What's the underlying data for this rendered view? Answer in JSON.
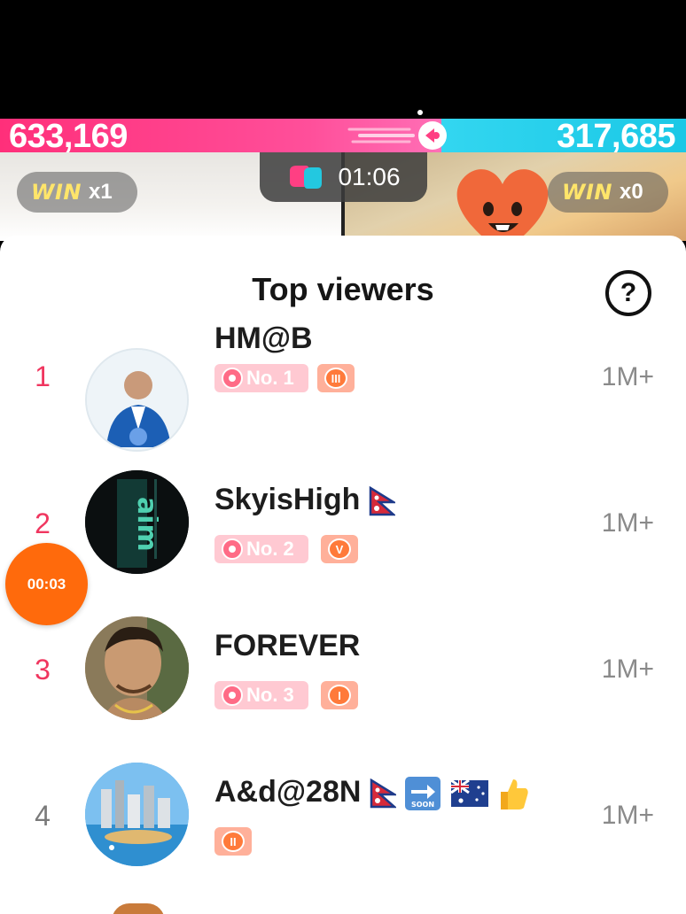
{
  "battle": {
    "left_score": "633,169",
    "right_score": "317,685",
    "timer": "01:06",
    "left_win_label": "WIN",
    "left_win_count": "x1",
    "right_win_label": "WIN",
    "right_win_count": "x0"
  },
  "sheet": {
    "title": "Top viewers",
    "help_icon": "?"
  },
  "viewers": [
    {
      "rank": "1",
      "name": "HM@B",
      "badge": "No. 1",
      "level_mark": "III",
      "amount": "1M+"
    },
    {
      "rank": "2",
      "name": "SkyisHigh",
      "badge": "No. 2",
      "level_mark": "V",
      "amount": "1M+"
    },
    {
      "rank": "3",
      "name": "FOREVER",
      "badge": "No. 3",
      "level_mark": "I",
      "amount": "1M+"
    },
    {
      "rank": "4",
      "name": "A&d@28N",
      "badge": "",
      "level_mark": "II",
      "amount": "1M+"
    }
  ],
  "floating_timer": "00:03",
  "colors": {
    "left_team": "#ff2f7a",
    "right_team": "#1ac8e6",
    "rank_top": "#f0365f",
    "floating_timer": "#ff6a0c"
  }
}
